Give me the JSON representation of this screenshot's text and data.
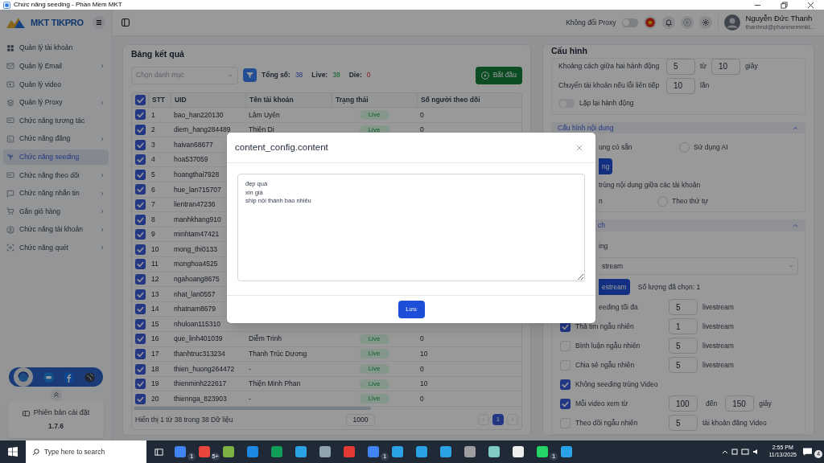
{
  "window": {
    "title": "Chức năng seeding - Phần Mềm MKT"
  },
  "sidebar": {
    "logo": "MKT TIKPRO",
    "items": [
      {
        "label": "Quản lý tài khoản",
        "selected": false,
        "has_submenu": false
      },
      {
        "label": "Quản lý Email",
        "selected": false,
        "has_submenu": true
      },
      {
        "label": "Quản lý video",
        "selected": false,
        "has_submenu": false
      },
      {
        "label": "Quản lý Proxy",
        "selected": false,
        "has_submenu": true
      },
      {
        "label": "Chức năng tương tác",
        "selected": false,
        "has_submenu": false
      },
      {
        "label": "Chức năng đăng",
        "selected": false,
        "has_submenu": true
      },
      {
        "label": "Chức năng seeding",
        "selected": true,
        "has_submenu": false
      },
      {
        "label": "Chức năng theo dõi",
        "selected": false,
        "has_submenu": true
      },
      {
        "label": "Chức năng nhắn tin",
        "selected": false,
        "has_submenu": true
      },
      {
        "label": "Gắn giỏ hàng",
        "selected": false,
        "has_submenu": true
      },
      {
        "label": "Chức năng tài khoản",
        "selected": false,
        "has_submenu": true
      },
      {
        "label": "Chức năng quét",
        "selected": false,
        "has_submenu": true
      }
    ],
    "version_label": "Phiên bản cài đặt",
    "version": "1.7.6"
  },
  "topbar": {
    "proxy_label": "Không đổi Proxy",
    "proxy_on": false,
    "user_name": "Nguyễn Đức Thanh",
    "user_email": "thanhnd@phanmemmkt..."
  },
  "results": {
    "title": "Bảng kết quả",
    "category_placeholder": "Chọn danh mục",
    "total_label": "Tổng số:",
    "total": "38",
    "live_label": "Live:",
    "live": "38",
    "die_label": "Die:",
    "die": "0",
    "start_button": "Bắt đầu",
    "columns": [
      "STT",
      "UID",
      "Tên tài khoản",
      "Trạng thái",
      "Số người theo dõi"
    ],
    "all_selected": true,
    "rows": [
      {
        "selected": true,
        "stt": "1",
        "uid": "bao_han220130",
        "name": "Lâm Uyên",
        "status": "Live",
        "followers": "0"
      },
      {
        "selected": true,
        "stt": "2",
        "uid": "diem_hang284489",
        "name": "Thiên Di",
        "status": "Live",
        "followers": "0"
      },
      {
        "selected": true,
        "stt": "3",
        "uid": "haivan68677"
      },
      {
        "selected": true,
        "stt": "4",
        "uid": "hoa537059"
      },
      {
        "selected": true,
        "stt": "5",
        "uid": "hoangthai7928"
      },
      {
        "selected": true,
        "stt": "6",
        "uid": "hue_lan715707"
      },
      {
        "selected": true,
        "stt": "7",
        "uid": "lientran47236"
      },
      {
        "selected": true,
        "stt": "8",
        "uid": "manhkhang910"
      },
      {
        "selected": true,
        "stt": "9",
        "uid": "minhtam47421"
      },
      {
        "selected": true,
        "stt": "10",
        "uid": "mong_thi0133"
      },
      {
        "selected": true,
        "stt": "11",
        "uid": "monghoa4525"
      },
      {
        "selected": true,
        "stt": "12",
        "uid": "ngahoang8675"
      },
      {
        "selected": true,
        "stt": "13",
        "uid": "nhat_lan0557"
      },
      {
        "selected": true,
        "stt": "14",
        "uid": "nhatnam8679"
      },
      {
        "selected": true,
        "stt": "15",
        "uid": "nhuloan115310"
      },
      {
        "selected": true,
        "stt": "16",
        "uid": "que_linh401039",
        "name": "Diễm Trinh",
        "status": "Live",
        "followers": "0"
      },
      {
        "selected": true,
        "stt": "17",
        "uid": "thanhtruc313234",
        "name": "Thanh Trúc Dương",
        "status": "Live",
        "followers": "10"
      },
      {
        "selected": true,
        "stt": "18",
        "uid": "thien_huong264472",
        "name": "-",
        "status": "Live",
        "followers": "0"
      },
      {
        "selected": true,
        "stt": "19",
        "uid": "thienminh222617",
        "name": "Thiện Minh Phan",
        "status": "Live",
        "followers": "10"
      },
      {
        "selected": true,
        "stt": "20",
        "uid": "thiennga_823903",
        "name": "-",
        "status": "Live",
        "followers": "0"
      }
    ],
    "summary": "Hiển thị 1 từ 38 trong 38 Dữ liệu",
    "page_size": "1000",
    "pages": [
      {
        "label": "1",
        "selected": true
      }
    ]
  },
  "config": {
    "title": "Cấu hình",
    "general": [
      {
        "kind": "range",
        "label": "Khoảng cách giữa hai hành động",
        "value": "5",
        "sep": "từ",
        "value2": "10",
        "unit": "giây"
      },
      {
        "kind": "single",
        "label": "Chuyển tài khoản nếu lỗi liên tiếp",
        "value": "10",
        "unit": "lần"
      }
    ],
    "repeat": {
      "label": "Lặp lại hành động",
      "on": false
    },
    "content_section": {
      "title": "Cấu hình nội dung",
      "expanded": true,
      "source_fragment": "ung có sẵn",
      "source_options": [
        {
          "label": "Sử dụng AI",
          "selected": false
        }
      ],
      "button_fragment": "ng",
      "order_label_fragment": "trùng nội dung giữa các tài khoản",
      "order_fragment": "n",
      "order_options": [
        {
          "label": "Theo thứ tự",
          "selected": false
        }
      ]
    },
    "seeding_section": {
      "title_fragment": "ch",
      "expanded": true,
      "field_label_fragment": "ing",
      "select_fragment": "stream",
      "button_fragment": "estream",
      "selected_count": "Số lượng đã chọn: 1",
      "options": [
        {
          "kind": "plain",
          "label": "eeding tối đa",
          "value": "5",
          "unit": "livestream"
        },
        {
          "kind": "check",
          "checked": true,
          "label": "Thả tim ngẫu nhiên",
          "value": "1",
          "unit": "livestream"
        },
        {
          "kind": "check",
          "checked": false,
          "label": "Bình luận ngẫu nhiên",
          "value": "5",
          "unit": "livestream"
        },
        {
          "kind": "check",
          "checked": false,
          "label": "Chia sẻ ngẫu nhiên",
          "value": "5",
          "unit": "livestream"
        },
        {
          "kind": "check",
          "checked": true,
          "label": "Không seeding trùng Video"
        },
        {
          "kind": "check",
          "checked": true,
          "label": "Mỗi video xem từ",
          "value": "100",
          "sep": "đến",
          "value2": "150",
          "unit": "giây"
        },
        {
          "kind": "check",
          "checked": false,
          "label": "Theo dõi ngẫu nhiên",
          "value": "5",
          "unit": "tài khoản đăng Video"
        }
      ]
    }
  },
  "modal": {
    "title": "content_config.content",
    "content": "đẹp quá\nxin giá\nship nội thành bao nhiêu",
    "save_button": "Lưu"
  },
  "taskbar": {
    "search_placeholder": "Type here to search",
    "apps": [
      {
        "color": "#4285f4",
        "badge": "1"
      },
      {
        "color": "#e8453c",
        "badge": "5+"
      },
      {
        "color": "#7cb342"
      },
      {
        "color": "#1e88e5"
      },
      {
        "color": "#0f9d58"
      },
      {
        "color": "#29a3e6"
      },
      {
        "color": "#90a4ae"
      },
      {
        "color": "#e53935"
      },
      {
        "color": "#4285f4",
        "badge": "1"
      },
      {
        "color": "#29a3e6"
      },
      {
        "color": "#29a3e6"
      },
      {
        "color": "#29a3e6"
      },
      {
        "color": "#9e9e9e"
      },
      {
        "color": "#80cbc4"
      },
      {
        "color": "#eeeeee"
      },
      {
        "color": "#25d366",
        "badge": "1"
      },
      {
        "color": "#29a3e6"
      }
    ],
    "time": "2:55 PM",
    "date": "11/13/2025",
    "notifications": "4"
  }
}
